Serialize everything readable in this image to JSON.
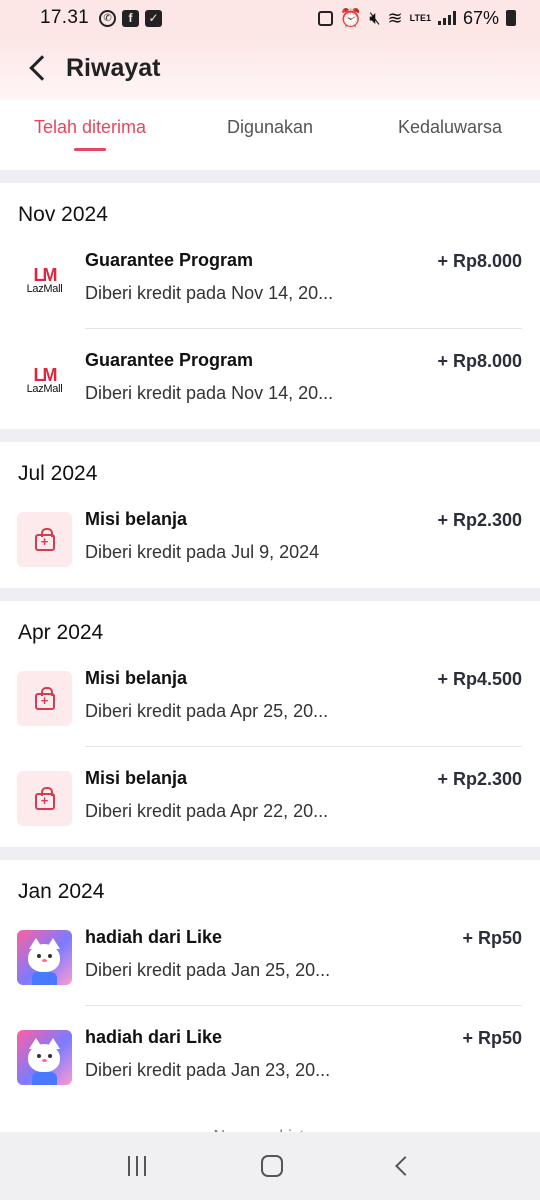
{
  "status_bar": {
    "time": "17.31",
    "battery": "67%",
    "network": "LTE1"
  },
  "header": {
    "title": "Riwayat"
  },
  "tabs": [
    {
      "label": "Telah diterima",
      "active": true
    },
    {
      "label": "Digunakan",
      "active": false
    },
    {
      "label": "Kedaluwarsa",
      "active": false
    }
  ],
  "sections": [
    {
      "month": "Nov 2024",
      "items": [
        {
          "icon": "lazmall-logo",
          "logo_mark": "LM",
          "logo_text": "LazMall",
          "title": "Guarantee Program",
          "subtitle": "Diberi kredit pada Nov 14, 20...",
          "amount": "+ Rp8.000"
        },
        {
          "icon": "lazmall-logo",
          "logo_mark": "LM",
          "logo_text": "LazMall",
          "title": "Guarantee Program",
          "subtitle": "Diberi kredit pada Nov 14, 20...",
          "amount": "+ Rp8.000"
        }
      ]
    },
    {
      "month": "Jul 2024",
      "items": [
        {
          "icon": "shopping-bag-icon",
          "title": "Misi belanja",
          "subtitle": "Diberi kredit pada Jul 9, 2024",
          "amount": "+ Rp2.300"
        }
      ]
    },
    {
      "month": "Apr 2024",
      "items": [
        {
          "icon": "shopping-bag-icon",
          "title": "Misi belanja",
          "subtitle": "Diberi kredit pada Apr 25, 20...",
          "amount": "+ Rp4.500"
        },
        {
          "icon": "shopping-bag-icon",
          "title": "Misi belanja",
          "subtitle": "Diberi kredit pada Apr 22, 20...",
          "amount": "+ Rp2.300"
        }
      ]
    },
    {
      "month": "Jan 2024",
      "items": [
        {
          "icon": "cat-avatar-icon",
          "title": "hadiah dari Like",
          "subtitle": "Diberi kredit pada Jan 25, 20...",
          "amount": "+ Rp50"
        },
        {
          "icon": "cat-avatar-icon",
          "title": "hadiah dari Like",
          "subtitle": "Diberi kredit pada Jan 23, 20...",
          "amount": "+ Rp50"
        }
      ]
    }
  ],
  "footer": {
    "no_more": "No more history"
  },
  "colors": {
    "accent": "#e8465f",
    "header_bg": "#fde6e6",
    "separator": "#eeeef3"
  }
}
